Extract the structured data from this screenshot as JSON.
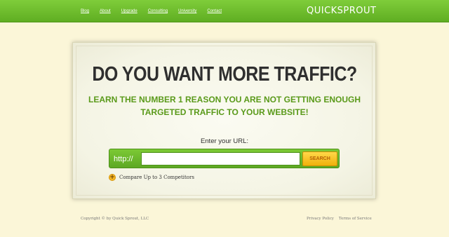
{
  "nav": {
    "items": [
      "Blog",
      "About",
      "Upgrade",
      "Consulting",
      "University",
      "Contact"
    ]
  },
  "logo": {
    "text": "QUICKSPROUT"
  },
  "hero": {
    "headline": "DO YOU WANT MORE TRAFFIC?",
    "subhead_line1": "LEARN THE NUMBER 1 REASON YOU ARE NOT GETTING ENOUGH",
    "subhead_line2": "TARGETED TRAFFIC TO YOUR WEBSITE!"
  },
  "url_form": {
    "label": "Enter your URL:",
    "prefix": "http://",
    "value": "",
    "button_label": "SEARCH"
  },
  "compare": {
    "icon": "plus-icon",
    "label": "Compare Up to 3 Competitors"
  },
  "footer": {
    "copyright": "Copyright © by Quick Sprout, LLC",
    "links": [
      "Privacy Policy",
      "Terms of Service"
    ]
  },
  "colors": {
    "header_green": "#6fbe2e",
    "accent_green": "#5a9a1a",
    "button_yellow": "#f5c227",
    "page_background": "#fbf6d8"
  }
}
